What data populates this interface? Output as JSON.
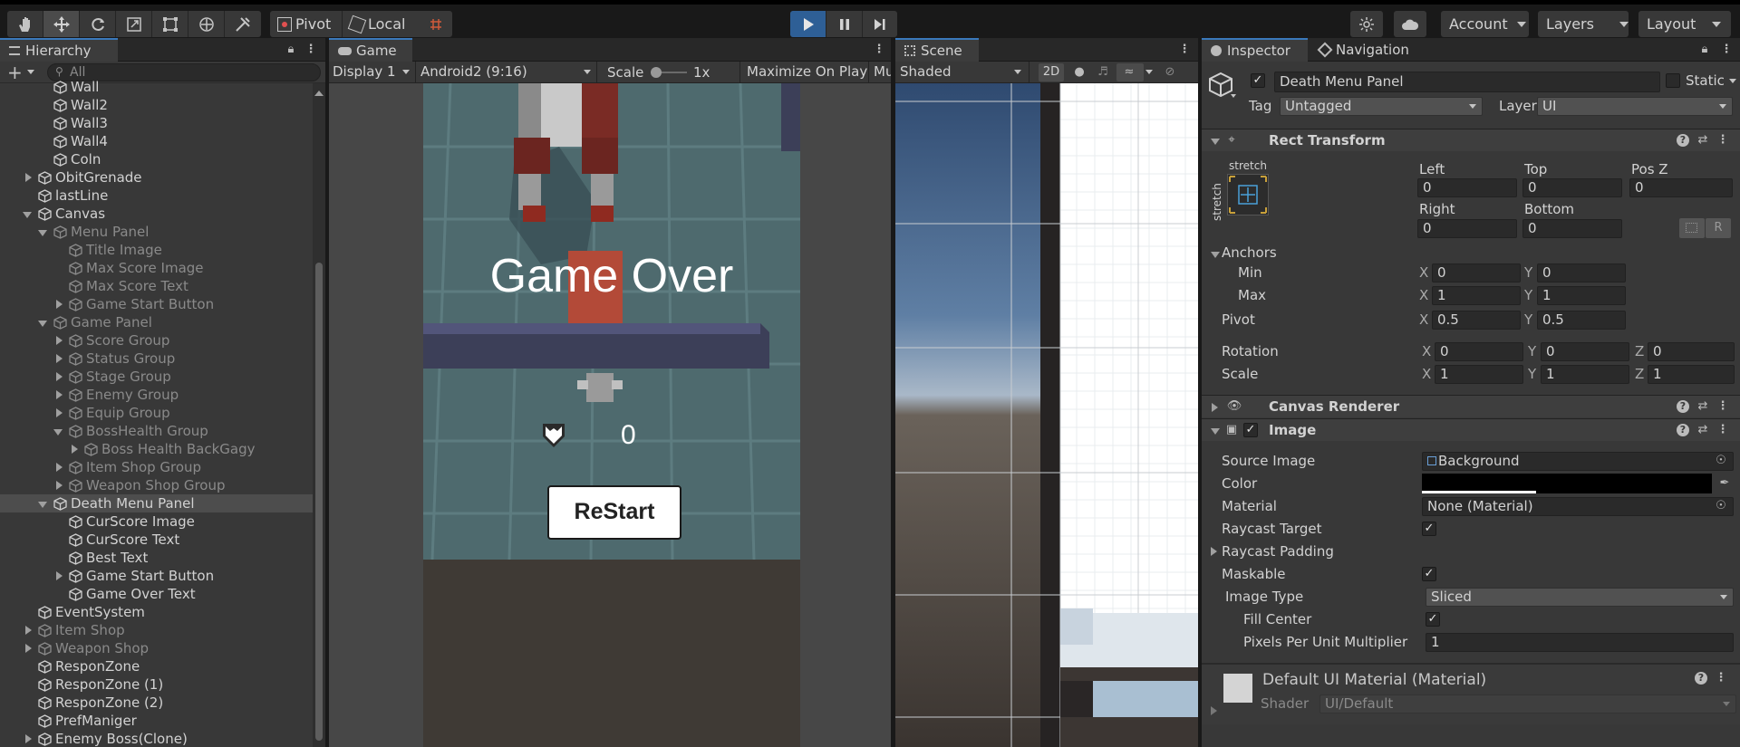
{
  "toolbar": {
    "tools": [
      "hand-tool",
      "move-tool",
      "rotate-tool",
      "scale-tool",
      "rect-tool",
      "transform-tool",
      "custom-tool"
    ],
    "pivot_label": "Pivot",
    "local_label": "Local",
    "account_label": "Account",
    "layers_label": "Layers",
    "layout_label": "Layout"
  },
  "hierarchy": {
    "tab_label": "Hierarchy",
    "search_placeholder": "All",
    "items": [
      {
        "label": "Wall",
        "indent": 3,
        "arrow": "none",
        "dim": false
      },
      {
        "label": "Wall2",
        "indent": 3,
        "arrow": "none",
        "dim": false
      },
      {
        "label": "Wall3",
        "indent": 3,
        "arrow": "none",
        "dim": false
      },
      {
        "label": "Wall4",
        "indent": 3,
        "arrow": "none",
        "dim": false
      },
      {
        "label": "Coln",
        "indent": 3,
        "arrow": "none",
        "dim": false
      },
      {
        "label": "ObitGrenade",
        "indent": 2,
        "arrow": "closed",
        "dim": false
      },
      {
        "label": "lastLine",
        "indent": 2,
        "arrow": "none",
        "dim": false
      },
      {
        "label": "Canvas",
        "indent": 2,
        "arrow": "open",
        "dim": false
      },
      {
        "label": "Menu Panel",
        "indent": 3,
        "arrow": "open",
        "dim": true
      },
      {
        "label": "Title Image",
        "indent": 4,
        "arrow": "none",
        "dim": true
      },
      {
        "label": "Max Score Image",
        "indent": 4,
        "arrow": "none",
        "dim": true
      },
      {
        "label": "Max Score Text",
        "indent": 4,
        "arrow": "none",
        "dim": true
      },
      {
        "label": "Game Start Button",
        "indent": 4,
        "arrow": "closed",
        "dim": true
      },
      {
        "label": "Game Panel",
        "indent": 3,
        "arrow": "open",
        "dim": true
      },
      {
        "label": "Score Group",
        "indent": 4,
        "arrow": "closed",
        "dim": true
      },
      {
        "label": "Status Group",
        "indent": 4,
        "arrow": "closed",
        "dim": true
      },
      {
        "label": "Stage Group",
        "indent": 4,
        "arrow": "closed",
        "dim": true
      },
      {
        "label": "Enemy Group",
        "indent": 4,
        "arrow": "closed",
        "dim": true
      },
      {
        "label": "Equip Group",
        "indent": 4,
        "arrow": "closed",
        "dim": true
      },
      {
        "label": "BossHealth Group",
        "indent": 4,
        "arrow": "open",
        "dim": true
      },
      {
        "label": "Boss Health BackGagy",
        "indent": 5,
        "arrow": "closed",
        "dim": true
      },
      {
        "label": "Item Shop Group",
        "indent": 4,
        "arrow": "closed",
        "dim": true
      },
      {
        "label": "Weapon Shop Group",
        "indent": 4,
        "arrow": "closed",
        "dim": true
      },
      {
        "label": "Death Menu Panel",
        "indent": 3,
        "arrow": "open",
        "dim": false,
        "selected": true
      },
      {
        "label": "CurScore Image",
        "indent": 4,
        "arrow": "none",
        "dim": false
      },
      {
        "label": "CurScore Text",
        "indent": 4,
        "arrow": "none",
        "dim": false
      },
      {
        "label": "Best Text",
        "indent": 4,
        "arrow": "none",
        "dim": false
      },
      {
        "label": "Game Start Button",
        "indent": 4,
        "arrow": "closed",
        "dim": false
      },
      {
        "label": "Game Over Text",
        "indent": 4,
        "arrow": "none",
        "dim": false
      },
      {
        "label": "EventSystem",
        "indent": 2,
        "arrow": "none",
        "dim": false
      },
      {
        "label": "Item Shop",
        "indent": 2,
        "arrow": "closed",
        "dim": true
      },
      {
        "label": "Weapon Shop",
        "indent": 2,
        "arrow": "closed",
        "dim": true
      },
      {
        "label": "ResponZone",
        "indent": 2,
        "arrow": "none",
        "dim": false
      },
      {
        "label": "ResponZone (1)",
        "indent": 2,
        "arrow": "none",
        "dim": false
      },
      {
        "label": "ResponZone (2)",
        "indent": 2,
        "arrow": "none",
        "dim": false
      },
      {
        "label": "PrefManiger",
        "indent": 2,
        "arrow": "none",
        "dim": false
      },
      {
        "label": "Enemy Boss(Clone)",
        "indent": 2,
        "arrow": "closed",
        "dim": false
      }
    ]
  },
  "game": {
    "tab_label": "Game",
    "display_label": "Display 1",
    "resolution_label": "Android2 (9:16)",
    "scale_label": "Scale",
    "scale_value": "1x",
    "maximize_label": "Maximize On Play",
    "mute_label": "Mu",
    "game_over_text": "Game Over",
    "score_value": "0",
    "restart_label": "ReStart"
  },
  "scene": {
    "tab_label": "Scene",
    "shading_label": "Shaded",
    "mode_2d_label": "2D"
  },
  "inspector": {
    "tab_label": "Inspector",
    "nav_tab_label": "Navigation",
    "object_name": "Death Menu Panel",
    "static_label": "Static",
    "tag_label": "Tag",
    "tag_value": "Untagged",
    "layer_label": "Layer",
    "layer_value": "UI",
    "rect_transform": {
      "title": "Rect Transform",
      "anchor_preset_label": "stretch",
      "anchor_side_label": "stretch",
      "left_label": "Left",
      "left_value": "0",
      "top_label": "Top",
      "top_value": "0",
      "posz_label": "Pos Z",
      "posz_value": "0",
      "right_label": "Right",
      "right_value": "0",
      "bottom_label": "Bottom",
      "bottom_value": "0",
      "r_button": "R",
      "anchors_label": "Anchors",
      "min_label": "Min",
      "min_x": "0",
      "min_y": "0",
      "max_label": "Max",
      "max_x": "1",
      "max_y": "1",
      "pivot_label": "Pivot",
      "pivot_x": "0.5",
      "pivot_y": "0.5",
      "rotation_label": "Rotation",
      "rot_x": "0",
      "rot_y": "0",
      "rot_z": "0",
      "scale_label": "Scale",
      "scale_x": "1",
      "scale_y": "1",
      "scale_z": "1",
      "x": "X",
      "y": "Y",
      "z": "Z"
    },
    "canvas_renderer_title": "Canvas Renderer",
    "image": {
      "title": "Image",
      "source_label": "Source Image",
      "source_value": "Background",
      "color_label": "Color",
      "material_label": "Material",
      "material_value": "None (Material)",
      "raycast_label": "Raycast Target",
      "raycast_padding_label": "Raycast Padding",
      "maskable_label": "Maskable",
      "image_type_label": "Image Type",
      "image_type_value": "Sliced",
      "fill_center_label": "Fill Center",
      "ppu_label": "Pixels Per Unit Multiplier",
      "ppu_value": "1"
    },
    "material": {
      "title": "Default UI Material (Material)",
      "shader_label": "Shader",
      "shader_value": "UI/Default"
    }
  }
}
